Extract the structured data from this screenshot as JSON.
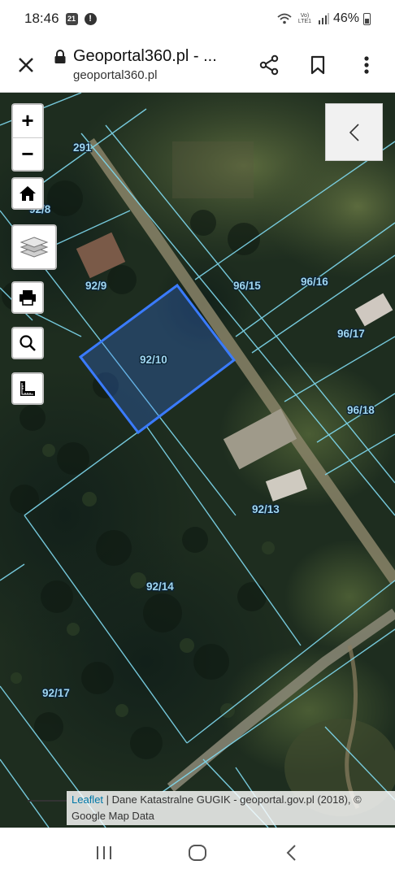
{
  "status_bar": {
    "time": "18:46",
    "notification_badge": "21",
    "network": "Vo) LTE1",
    "battery": "46%"
  },
  "browser": {
    "title": "Geoportal360.pl - ...",
    "url": "geoportal360.pl",
    "icons": [
      "close-icon",
      "lock-icon",
      "share-icon",
      "bookmark-icon",
      "more-vert-icon"
    ]
  },
  "map": {
    "controls": {
      "zoom_in": "+",
      "zoom_out": "−",
      "icons": [
        "home-icon",
        "layers-icon",
        "print-icon",
        "search-icon",
        "measure-icon",
        "chevron-left-icon"
      ]
    },
    "parcels": [
      "291",
      "92/8",
      "92/9",
      "92/10",
      "96/15",
      "96/16",
      "96/17",
      "96/18",
      "92/13",
      "92/14",
      "92/17"
    ],
    "selected_parcel": "92/10",
    "selection_color": "#3a7bff",
    "parcel_line_color": "#7fd9ef",
    "attribution": {
      "link": "Leaflet",
      "text": "| Dane Katastralne GUGIK - geoportal.gov.pl (2018), © Google Map Data"
    }
  },
  "nav_bar": {
    "icons": [
      "recent-apps-icon",
      "home-button-icon",
      "back-icon"
    ]
  }
}
